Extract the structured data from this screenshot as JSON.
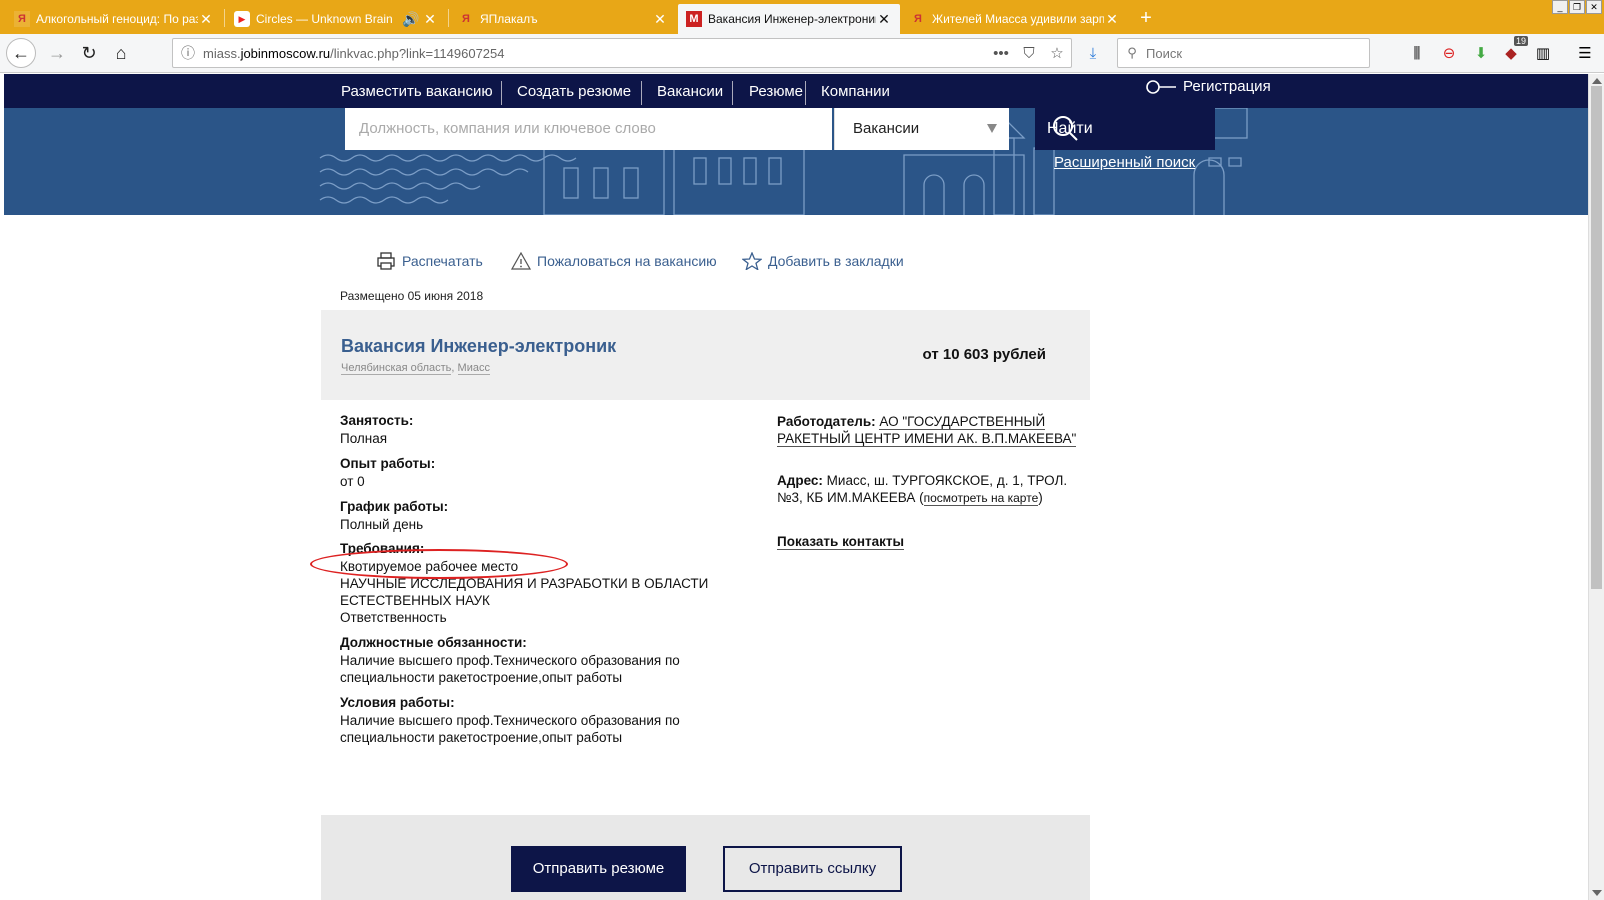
{
  "tabs": [
    {
      "title": "Алкогольный геноцид: По разум",
      "icon": "yaplakal-icon",
      "active": false
    },
    {
      "title": "Circles — Unknown Brain",
      "icon": "youtube-icon",
      "active": false
    },
    {
      "title": "ЯПлакалъ",
      "icon": "yaplakal-icon",
      "active": false
    },
    {
      "title": "Вакансия Инженер-электроник,",
      "icon": "m-logo-icon",
      "active": true
    },
    {
      "title": "Жителей Миасса удивили зарп",
      "icon": "yaplakal-icon",
      "active": false
    }
  ],
  "browser": {
    "url_prefix": "miass.",
    "url_domain": "jobinmoscow.ru",
    "url_path": "/linkvac.php?link=1149607254",
    "search_placeholder": "Поиск",
    "badge_count": "19"
  },
  "site_nav": {
    "items": [
      "Разместить вакансию",
      "Создать резюме",
      "Вакансии",
      "Резюме",
      "Компании"
    ],
    "register_label": "Регистрация"
  },
  "search": {
    "placeholder": "Должность, компания или ключевое слово",
    "type_selected": "Вакансии",
    "button_label": "Найти",
    "advanced_label": "Расширенный поиск"
  },
  "actions": {
    "print": "Распечатать",
    "complain": "Пожаловаться на вакансию",
    "bookmark": "Добавить в закладки"
  },
  "vacancy": {
    "posted": "Размещено 05 июня 2018",
    "title": "Вакансия Инженер-электроник",
    "region": "Челябинская область",
    "city": "Миасс",
    "salary": "от 10 603 рублей",
    "employment_label": "Занятость:",
    "employment_value": "Полная",
    "experience_label": "Опыт работы:",
    "experience_value": "от 0",
    "schedule_label": "График работы:",
    "schedule_value": "Полный день",
    "requirements_label": "Требования:",
    "requirements_lines": [
      "Квотируемое рабочее место",
      "НАУЧНЫЕ ИССЛЕДОВАНИЯ И РАЗРАБОТКИ В ОБЛАСТИ ЕСТЕСТВЕННЫХ НАУК",
      "Ответственность"
    ],
    "duties_label": "Должностные обязанности:",
    "duties_value": "Наличие высшего проф.Технического образования по специальности ракетостроение,опыт работы",
    "conditions_label": "Условия работы:",
    "conditions_value": "Наличие высшего проф.Технического образования по специальности ракетостроение,опыт работы",
    "employer_label": "Работодатель:",
    "employer_value": "АО \"ГОСУДАРСТВЕННЫЙ РАКЕТНЫЙ ЦЕНТР ИМЕНИ АК. В.П.МАКЕЕВА\"",
    "address_label": "Адрес:",
    "address_value": "Миасс, ш. ТУРГОЯКСКОЕ, д. 1, ТРОЛ. №3, КБ ИМ.МАКЕЕВА",
    "map_link": "посмотреть на карте",
    "show_contacts": "Показать контакты"
  },
  "buttons": {
    "send_resume": "Отправить резюме",
    "send_link": "Отправить ссылку"
  },
  "colors": {
    "tabbar": "#e8a717",
    "site_nav": "#0d1548",
    "hero": "#2b5588",
    "link": "#3a5f8f",
    "annotation": "#dd2222"
  }
}
